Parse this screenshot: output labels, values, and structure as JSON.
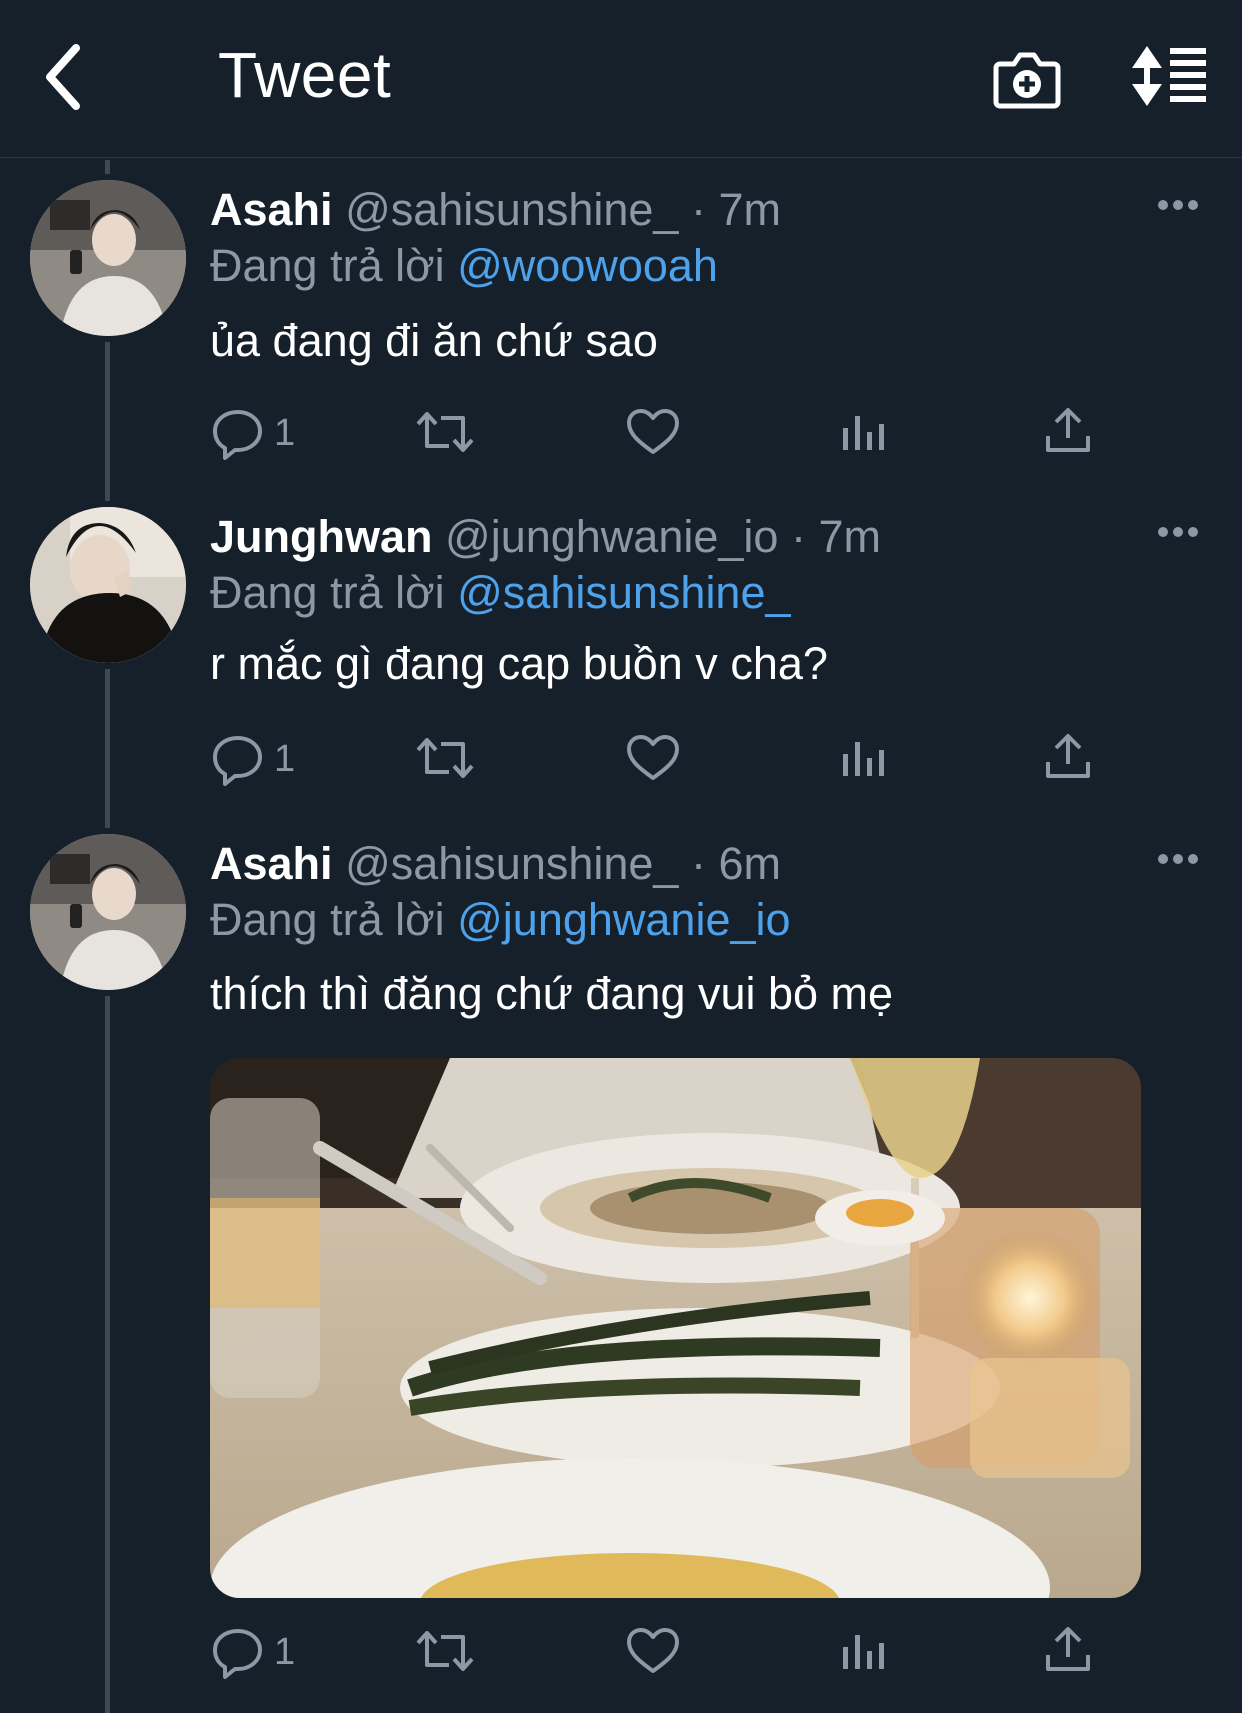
{
  "header": {
    "title": "Tweet",
    "back_icon": "chevron-left-icon",
    "camera_icon": "camera-plus-icon",
    "sort_icon": "sort-list-icon"
  },
  "colors": {
    "background": "#15202b",
    "secondary_text": "#8b98a5",
    "mention": "#4ea2eb",
    "thread_line": "#3d4a56"
  },
  "tweets": [
    {
      "name": "Asahi",
      "handle": "@sahisunshine_",
      "separator": "·",
      "time": "7m",
      "reply_prefix": "Đang trả lời",
      "reply_to": "@woowooah",
      "text": "ủa đang đi ăn chứ sao",
      "reply_count": "1"
    },
    {
      "name": "Junghwan",
      "handle": "@junghwanie_io",
      "separator": "·",
      "time": "7m",
      "reply_prefix": "Đang trả lời",
      "reply_to": "@sahisunshine_",
      "text": "r mắc gì đang cap buồn v cha?",
      "reply_count": "1"
    },
    {
      "name": "Asahi",
      "handle": "@sahisunshine_",
      "separator": "·",
      "time": "6m",
      "reply_prefix": "Đang trả lời",
      "reply_to": "@junghwanie_io",
      "text": "thích thì đăng chứ đang vui bỏ mẹ",
      "reply_count": "1"
    }
  ]
}
